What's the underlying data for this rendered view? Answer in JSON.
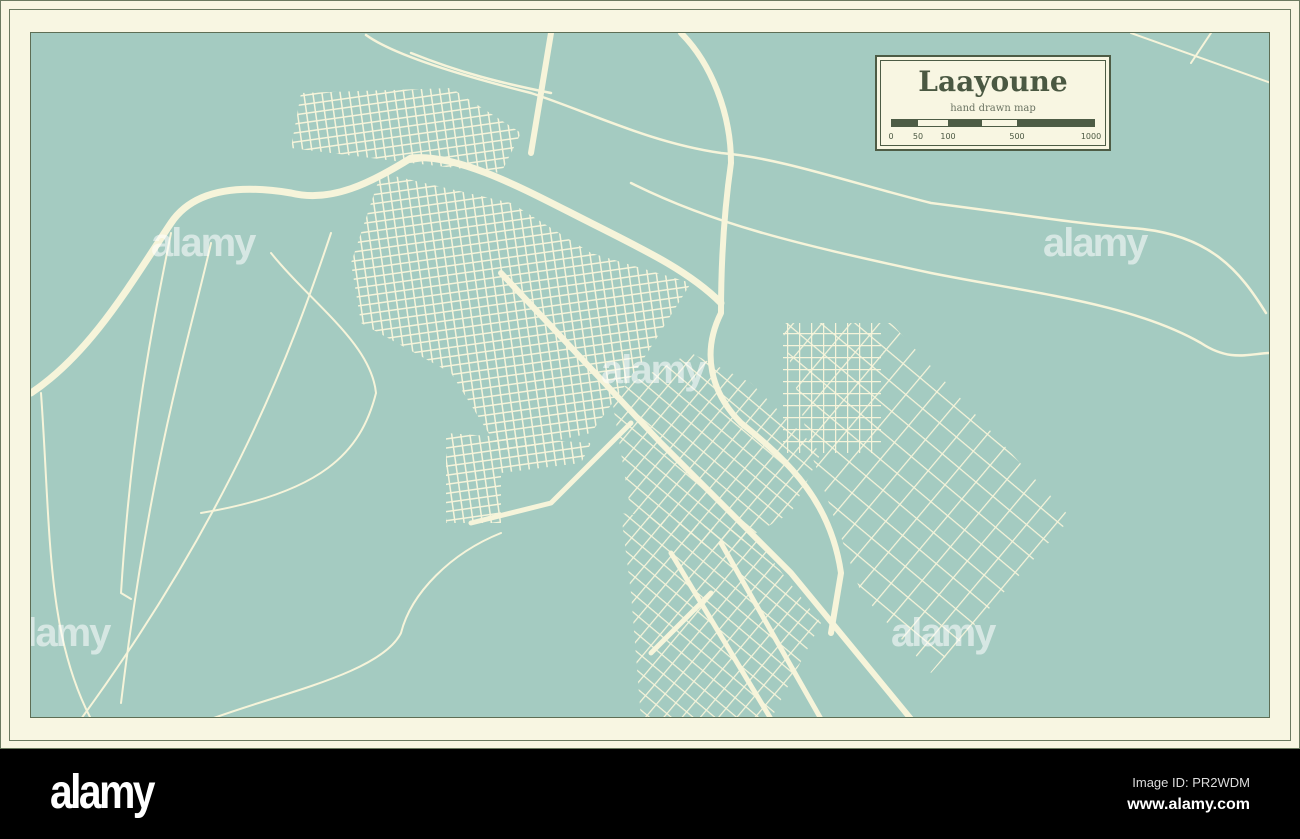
{
  "map": {
    "title": "Laayoune",
    "subtitle": "hand drawn map",
    "scale_ticks": [
      "0",
      "50",
      "100",
      "500",
      "1000"
    ],
    "colors": {
      "water_bg": "#a4cbc1",
      "roads": "#f6f4da",
      "frame": "#f8f6e2",
      "ink": "#4d5c45"
    }
  },
  "watermark": {
    "text": "alamy",
    "small": "a"
  },
  "footer": {
    "logo": "alamy",
    "image_id": "Image ID: PR2WDM",
    "url": "www.alamy.com"
  }
}
